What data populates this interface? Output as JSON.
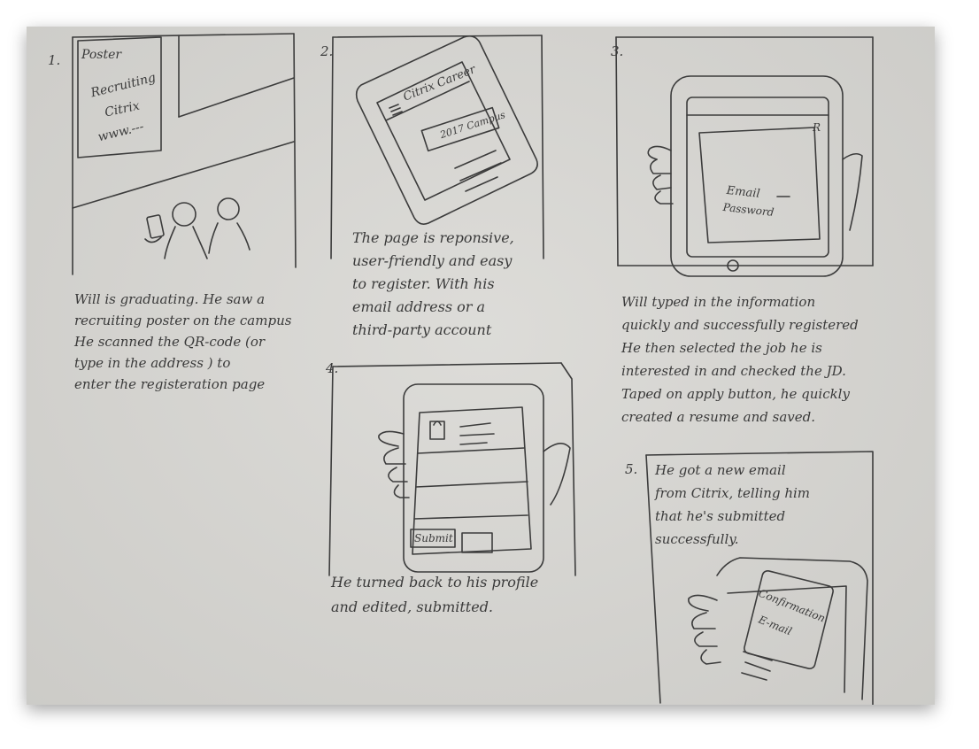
{
  "panels": [
    {
      "number": "1.",
      "sketch_text": [
        "Poster",
        "Recruiting",
        "Citrix",
        "www.---"
      ],
      "caption": [
        "Will is graduating. He saw a",
        "recruiting poster on the campus",
        "He scanned the QR-code (or",
        "type in the address ) to",
        "enter the registeration page"
      ]
    },
    {
      "number": "2.",
      "sketch_text": [
        "Citrix Career",
        "2017 Campus"
      ],
      "caption": [
        "The page is reponsive,",
        "user-friendly and easy",
        "to register. With his",
        "email address or a",
        "third-party account"
      ]
    },
    {
      "number": "3.",
      "sketch_text": [
        "Email",
        "Password",
        "R"
      ],
      "caption": [
        "Will typed in the information",
        "quickly and successfully registered",
        "He then selected the job he is",
        "interested in and checked the JD.",
        "Taped on apply button, he quickly",
        "created a resume and saved."
      ]
    },
    {
      "number": "4.",
      "sketch_text": [
        "Submit"
      ],
      "caption": [
        "He turned back to his profile",
        "and edited, submitted."
      ]
    },
    {
      "number": "5.",
      "sketch_text": [
        "Confirmation",
        "E-mail"
      ],
      "caption": [
        "He got a new email",
        "from Citrix, telling him",
        "that he's submitted",
        "successfully."
      ]
    }
  ]
}
